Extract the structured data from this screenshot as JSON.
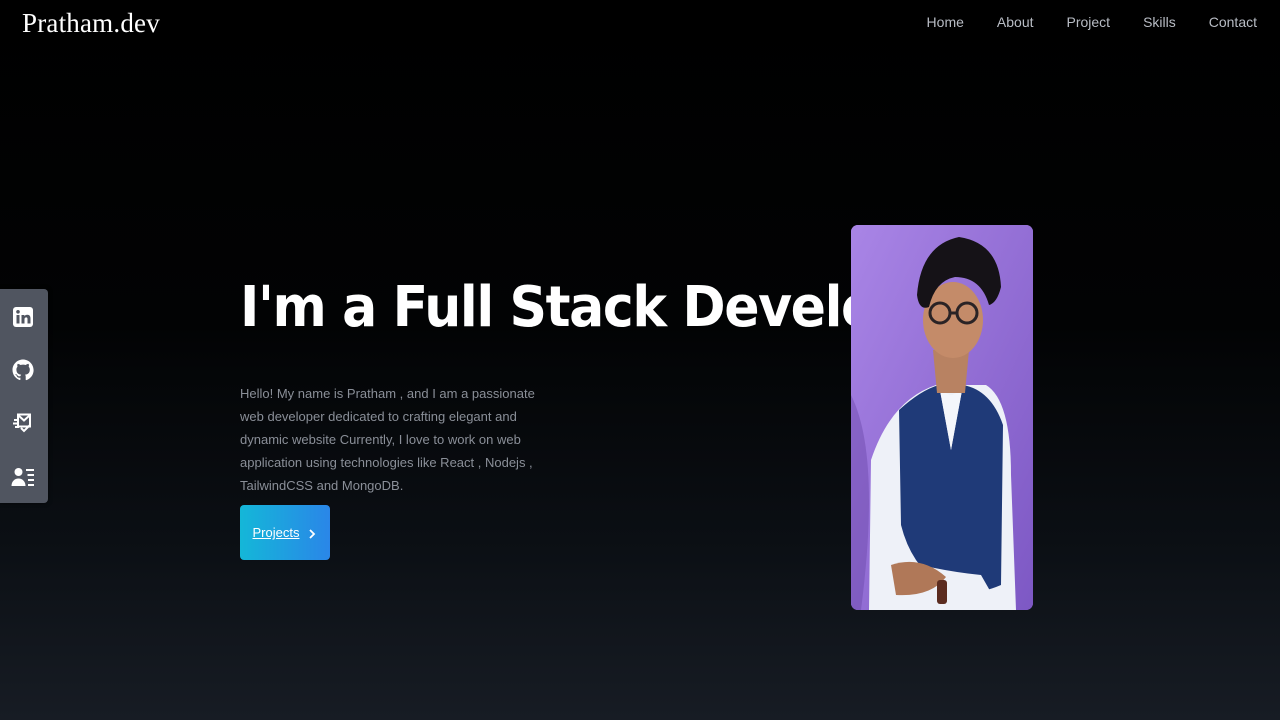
{
  "brand": "Pratham.dev",
  "nav": {
    "items": [
      "Home",
      "About",
      "Project",
      "Skills",
      "Contact"
    ]
  },
  "social": {
    "icons": [
      "linkedin-icon",
      "github-icon",
      "mail-icon",
      "resume-icon"
    ]
  },
  "hero": {
    "title": "I'm a Full Stack Developer",
    "description": "Hello! My name is Pratham , and I am a passionate web developer dedicated to crafting elegant and dynamic website Currently, I love to work on web application using technologies like React , Nodejs , TailwindCSS and MongoDB.",
    "cta_label": "Projects"
  },
  "colors": {
    "accent_start": "#14b7d8",
    "accent_end": "#2a86e8",
    "portrait_bg": "#9a76dc",
    "sidebar_bg": "#505560"
  }
}
